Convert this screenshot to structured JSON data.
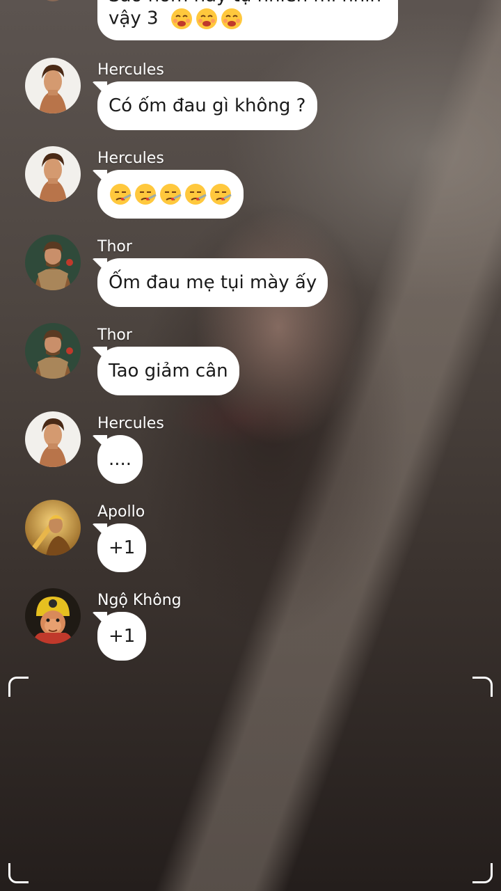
{
  "messages": [
    {
      "sender": "",
      "line1": "Sao hôm nay tự nhiên mi nhìn",
      "line2": "vậy 3",
      "emojis": [
        "weary-face",
        "weary-face",
        "weary-face"
      ],
      "avatar": "partial-avatar"
    },
    {
      "sender": "Hercules",
      "text": "Có ốm đau gì không ?",
      "avatar": "hercules-avatar"
    },
    {
      "sender": "Hercules",
      "text": "",
      "emojis": [
        "sick-thermometer-face",
        "sick-thermometer-face",
        "sick-thermometer-face",
        "sick-thermometer-face",
        "sick-thermometer-face"
      ],
      "avatar": "hercules-avatar"
    },
    {
      "sender": "Thor",
      "text": "Ốm đau mẹ tụi mày ấy",
      "avatar": "thor-avatar"
    },
    {
      "sender": "Thor",
      "text": "Tao giảm cân",
      "avatar": "thor-avatar"
    },
    {
      "sender": "Hercules",
      "text": "....",
      "avatar": "hercules-avatar"
    },
    {
      "sender": "Apollo",
      "text": "+1",
      "avatar": "apollo-avatar"
    },
    {
      "sender": "Ngộ Không",
      "text": "+1",
      "avatar": "ngo-khong-avatar"
    }
  ],
  "colors": {
    "bubble": "#ffffff",
    "text": "#1a1a1a",
    "name": "#ffffff"
  },
  "viewfinder": {
    "corners": [
      "top-left",
      "top-right",
      "bottom-left",
      "bottom-right"
    ]
  }
}
